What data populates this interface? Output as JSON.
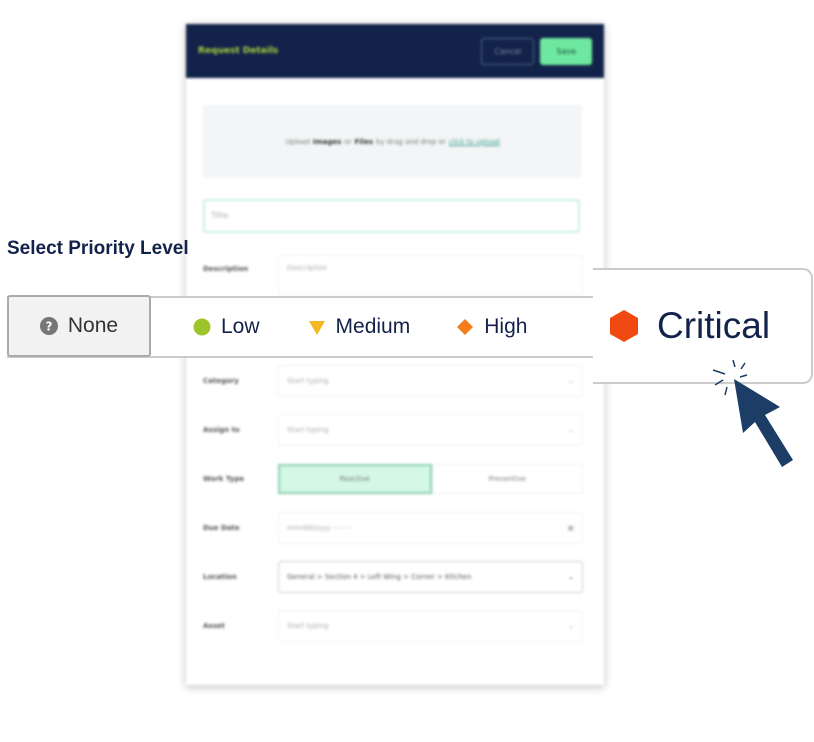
{
  "form": {
    "header": {
      "title": "Request Details",
      "cancel": "Cancel",
      "save": "Save"
    },
    "upload": {
      "pre": "Upload",
      "images": "Images",
      "or": "or",
      "files": "Files",
      "mid": "by drag and drop or",
      "link": "click to upload"
    },
    "title_placeholder": "Title",
    "description": {
      "label": "Description",
      "placeholder": "Description"
    },
    "category": {
      "label": "Category",
      "placeholder": "Start typing"
    },
    "assign_to": {
      "label": "Assign to",
      "placeholder": "Start typing"
    },
    "work_type": {
      "label": "Work Type",
      "options": [
        "Reactive",
        "Preventive"
      ],
      "selected": "Reactive"
    },
    "due_date": {
      "label": "Due Date",
      "placeholder": "mm/dd/yyyy --:-- --"
    },
    "location": {
      "label": "Location",
      "value": "General > Section 4 > Left Wing > Corner > Kitchen"
    },
    "asset": {
      "label": "Asset",
      "placeholder": "Start typing"
    }
  },
  "priority": {
    "heading": "Select Priority Level",
    "options": [
      {
        "label": "None",
        "icon": "question-circle-icon",
        "color": "#777777"
      },
      {
        "label": "Low",
        "icon": "circle-icon",
        "color": "#9dc52a"
      },
      {
        "label": "Medium",
        "icon": "triangle-down-icon",
        "color": "#f5b820"
      },
      {
        "label": "High",
        "icon": "diamond-icon",
        "color": "#f57c1a"
      },
      {
        "label": "Critical",
        "icon": "hexagon-icon",
        "color": "#f04a12"
      }
    ],
    "selected": "Critical"
  },
  "cursor": {
    "icon": "pointer-cursor-icon",
    "color": "#1c3d66"
  }
}
